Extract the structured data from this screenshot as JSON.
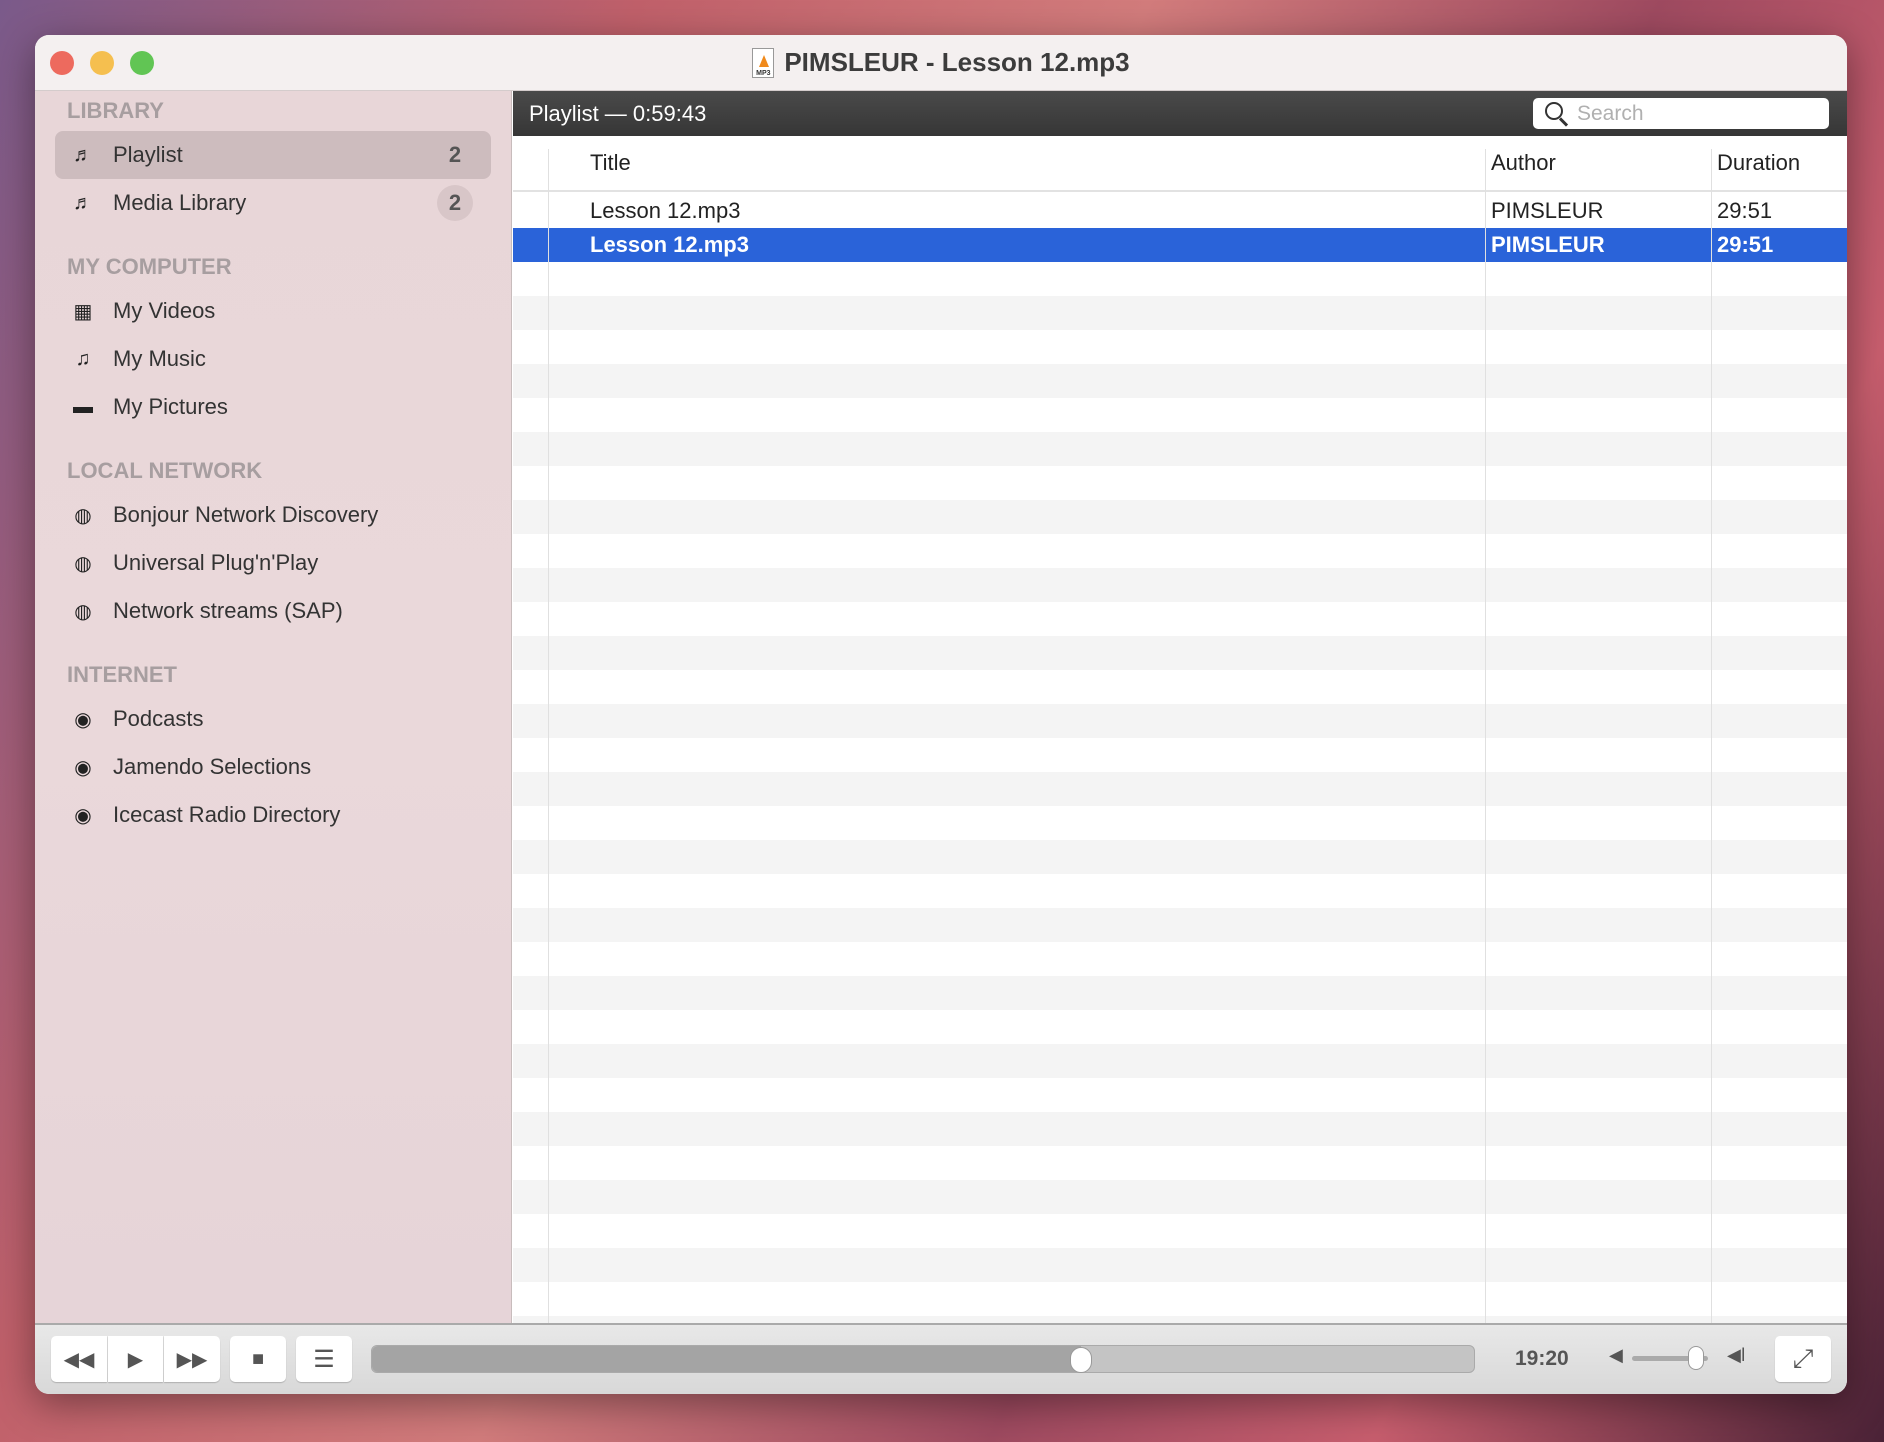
{
  "window": {
    "title": "PIMSLEUR - Lesson 12.mp3",
    "file_badge": "MP3"
  },
  "sidebar": {
    "sections": [
      {
        "title": "LIBRARY",
        "items": [
          {
            "label": "Playlist",
            "icon": "music-file-icon",
            "count": "2",
            "selected": true
          },
          {
            "label": "Media Library",
            "icon": "music-file-icon",
            "count": "2"
          }
        ]
      },
      {
        "title": "MY COMPUTER",
        "items": [
          {
            "label": "My Videos",
            "icon": "film-icon"
          },
          {
            "label": "My Music",
            "icon": "music-note-icon"
          },
          {
            "label": "My Pictures",
            "icon": "picture-icon"
          }
        ]
      },
      {
        "title": "LOCAL NETWORK",
        "items": [
          {
            "label": "Bonjour Network Discovery",
            "icon": "network-globe-icon"
          },
          {
            "label": "Universal Plug'n'Play",
            "icon": "network-globe-icon"
          },
          {
            "label": "Network streams (SAP)",
            "icon": "network-globe-icon"
          }
        ]
      },
      {
        "title": "INTERNET",
        "items": [
          {
            "label": "Podcasts",
            "icon": "podcast-icon"
          },
          {
            "label": "Jamendo Selections",
            "icon": "podcast-icon"
          },
          {
            "label": "Icecast Radio Directory",
            "icon": "podcast-icon"
          }
        ]
      }
    ]
  },
  "playlist": {
    "header": "Playlist — 0:59:43",
    "search_placeholder": "Search",
    "columns": [
      "Title",
      "Author",
      "Duration"
    ],
    "rows": [
      {
        "title": "Lesson 12.mp3",
        "author": "PIMSLEUR",
        "duration": "29:51"
      },
      {
        "title": "Lesson 12.mp3",
        "author": "PIMSLEUR",
        "duration": "29:51",
        "selected": true
      }
    ]
  },
  "controls": {
    "elapsed": "19:20",
    "progress_fraction": 0.643,
    "volume_fraction": 0.84
  },
  "colors": {
    "selection": "#2a63d9",
    "close": "#ed6a5e",
    "minimize": "#f5bf4f",
    "zoom": "#61c554"
  }
}
